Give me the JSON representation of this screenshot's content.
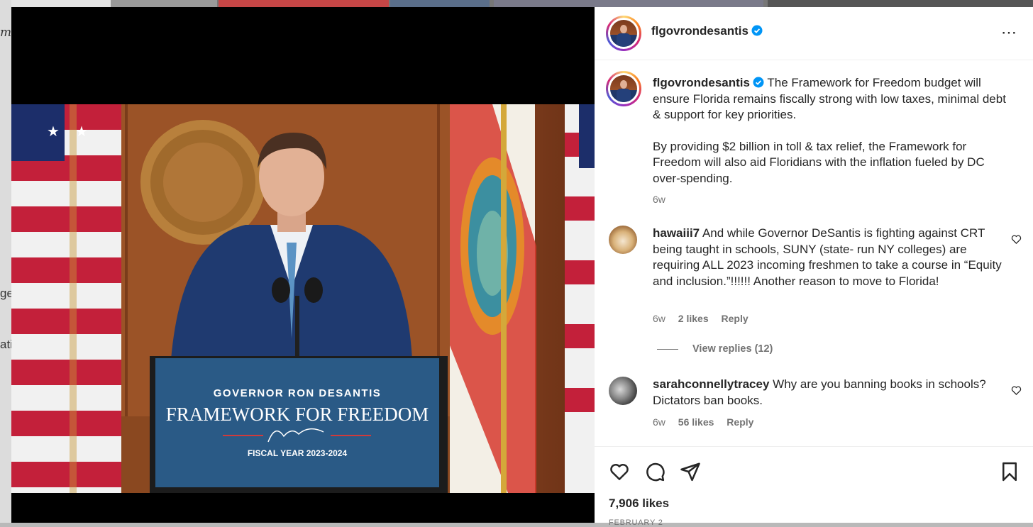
{
  "background": {
    "left_fragments": [
      "m",
      "ge",
      "ati"
    ]
  },
  "photo": {
    "podium_line1": "GOVERNOR RON DESANTIS",
    "podium_line2": "FRAMEWORK FOR FREEDOM",
    "podium_line3": "FISCAL YEAR 2023-2024"
  },
  "header": {
    "username": "flgovrondesantis",
    "more_icon": "⋯"
  },
  "caption": {
    "username": "flgovrondesantis",
    "paragraph1": "The Framework for Freedom budget will ensure Florida remains fiscally strong with low taxes, minimal debt & support for key priorities.",
    "paragraph2": "By providing $2 billion in toll & tax relief, the Framework for Freedom will also aid Floridians with the inflation fueled by DC over-spending.",
    "time": "6w"
  },
  "comments": [
    {
      "username": "hawaiii7",
      "text": "And while Governor DeSantis is fighting against CRT being taught in schools, SUNY (state- run NY colleges) are requiring ALL 2023 incoming freshmen to take a course in “Equity and inclusion.”!!!!!! Another reason to move to Florida!",
      "time": "6w",
      "likes": "2 likes",
      "reply": "Reply",
      "view_replies": "View replies (12)"
    },
    {
      "username": "sarahconnellytracey",
      "text": "Why are you banning books in schools? Dictators ban books.",
      "time": "6w",
      "likes": "56 likes",
      "reply": "Reply"
    }
  ],
  "footer": {
    "likes": "7,906 likes",
    "date": "FEBRUARY 2"
  },
  "icons": [
    "heart-icon",
    "comment-icon",
    "share-icon",
    "bookmark-icon",
    "verified-badge-icon",
    "more-options-icon"
  ],
  "colors": {
    "verified": "#0095f6",
    "muted": "#737373",
    "text": "#262626"
  }
}
